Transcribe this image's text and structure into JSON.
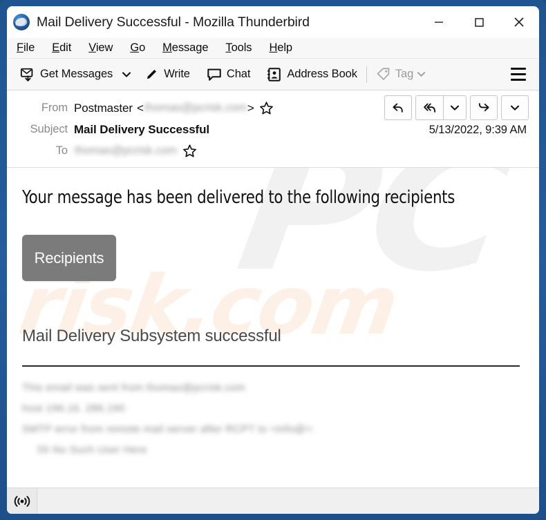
{
  "window": {
    "title": "Mail Delivery Successful - Mozilla Thunderbird",
    "app_icon": "thunderbird-icon",
    "frame_color": "#215a96",
    "controls": {
      "minimize": "minimize-icon",
      "maximize": "maximize-icon",
      "close": "close-icon"
    }
  },
  "menubar": {
    "items": [
      {
        "label": "File",
        "accesskey": "F"
      },
      {
        "label": "Edit",
        "accesskey": "E"
      },
      {
        "label": "View",
        "accesskey": "V"
      },
      {
        "label": "Go",
        "accesskey": "G"
      },
      {
        "label": "Message",
        "accesskey": "M"
      },
      {
        "label": "Tools",
        "accesskey": "T"
      },
      {
        "label": "Help",
        "accesskey": "H"
      }
    ]
  },
  "toolbar": {
    "get_messages_label": "Get Messages",
    "write_label": "Write",
    "chat_label": "Chat",
    "address_book_label": "Address Book",
    "tag_label": "Tag",
    "tag_disabled": true,
    "hamburger": "app-menu-icon"
  },
  "message_header": {
    "from_label": "From",
    "from_name": "Postmaster",
    "from_angle_open": "<",
    "from_address_redacted": "thomas@pcrisk.com",
    "from_angle_close": ">",
    "subject_label": "Subject",
    "subject_value": "Mail Delivery Successful",
    "to_label": "To",
    "to_address_redacted": "thomas@pcrisk.com",
    "date": "5/13/2022, 9:39 AM",
    "actions": {
      "reply": "reply-icon",
      "reply_all": "reply-all-icon",
      "reply_all_more": "chevron-down-icon",
      "forward": "forward-icon",
      "more": "chevron-down-icon"
    },
    "star": "star-icon"
  },
  "body": {
    "heading": "Your message has been delivered to the following recipients",
    "recipients_button_label": "Recipients",
    "recipients_button_color": "#7b7b7b",
    "subsystem_line": "Mail Delivery Subsystem successful",
    "footer_lines": [
      "This email was sent from thomas@pcrisk.com",
      "host 196.16. 286.190",
      "SMTP error from remote mail server after RCPT to <info@>:",
      "55 No Such User Here"
    ],
    "watermarks": {
      "primary": "PC",
      "secondary": "risk.com"
    }
  },
  "statusbar": {
    "online_icon": "broadcast-online-icon"
  }
}
